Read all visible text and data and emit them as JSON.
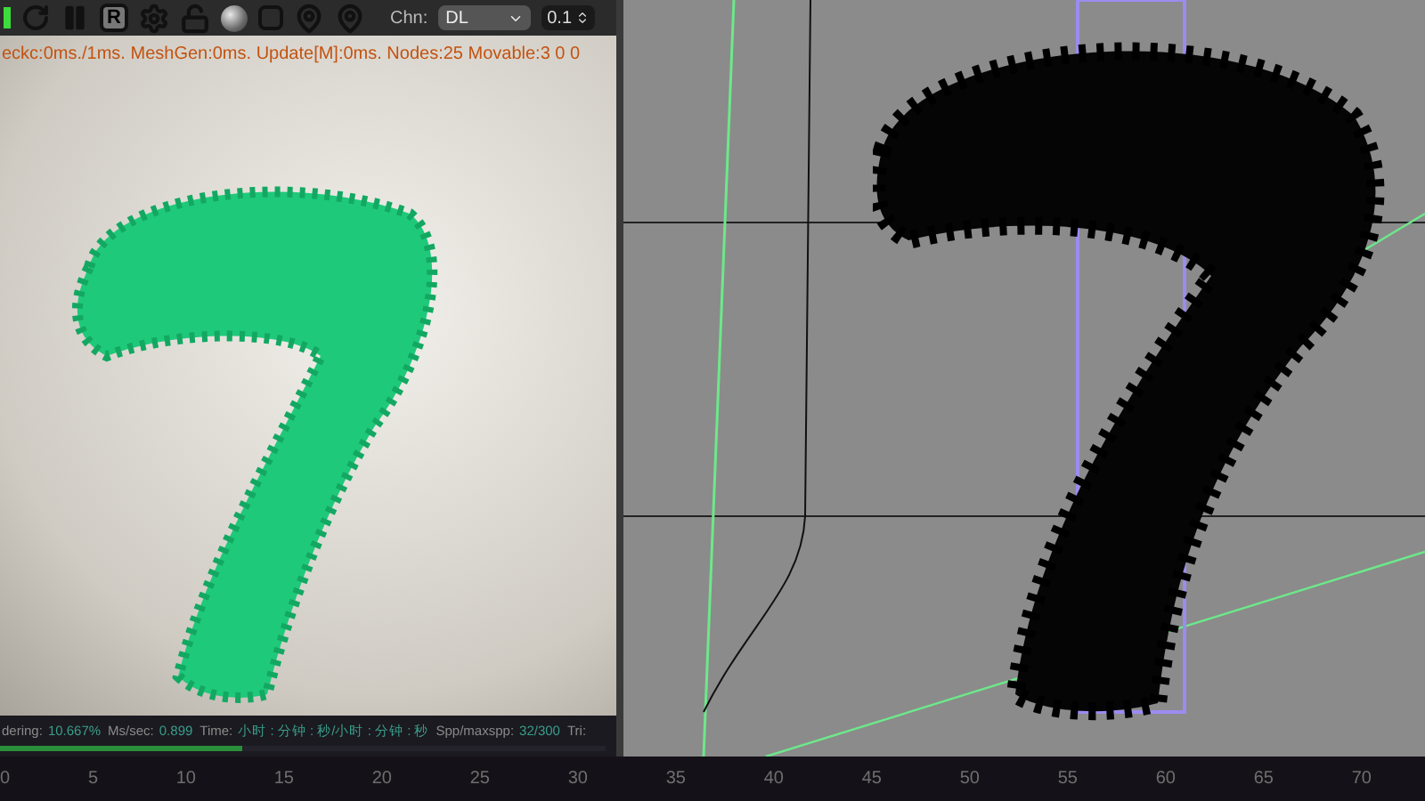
{
  "toolbar": {
    "region_letter": "R",
    "channel_label": "Chn:",
    "channel_value": "DL",
    "step_value": "0.1"
  },
  "info_line": "eckc:0ms./1ms. MeshGen:0ms. Update[M]:0ms. Nodes:25 Movable:3  0 0",
  "status_bar": {
    "progress": {
      "level": 0.4
    },
    "items": [
      {
        "label": "dering:",
        "value": "10.667%"
      },
      {
        "label": "Ms/sec:",
        "value": "0.899"
      },
      {
        "label": "Time:",
        "value": "小时 : 分钟 : 秒/小时 : 分钟 : 秒"
      },
      {
        "label": "Spp/maxspp:",
        "value": "32/300"
      },
      {
        "label": "Tri:"
      }
    ]
  },
  "timeline": {
    "ticks": [
      "0",
      "5",
      "10",
      "15",
      "20",
      "25",
      "30",
      "35",
      "40",
      "45",
      "50",
      "55",
      "60",
      "65",
      "70"
    ]
  }
}
